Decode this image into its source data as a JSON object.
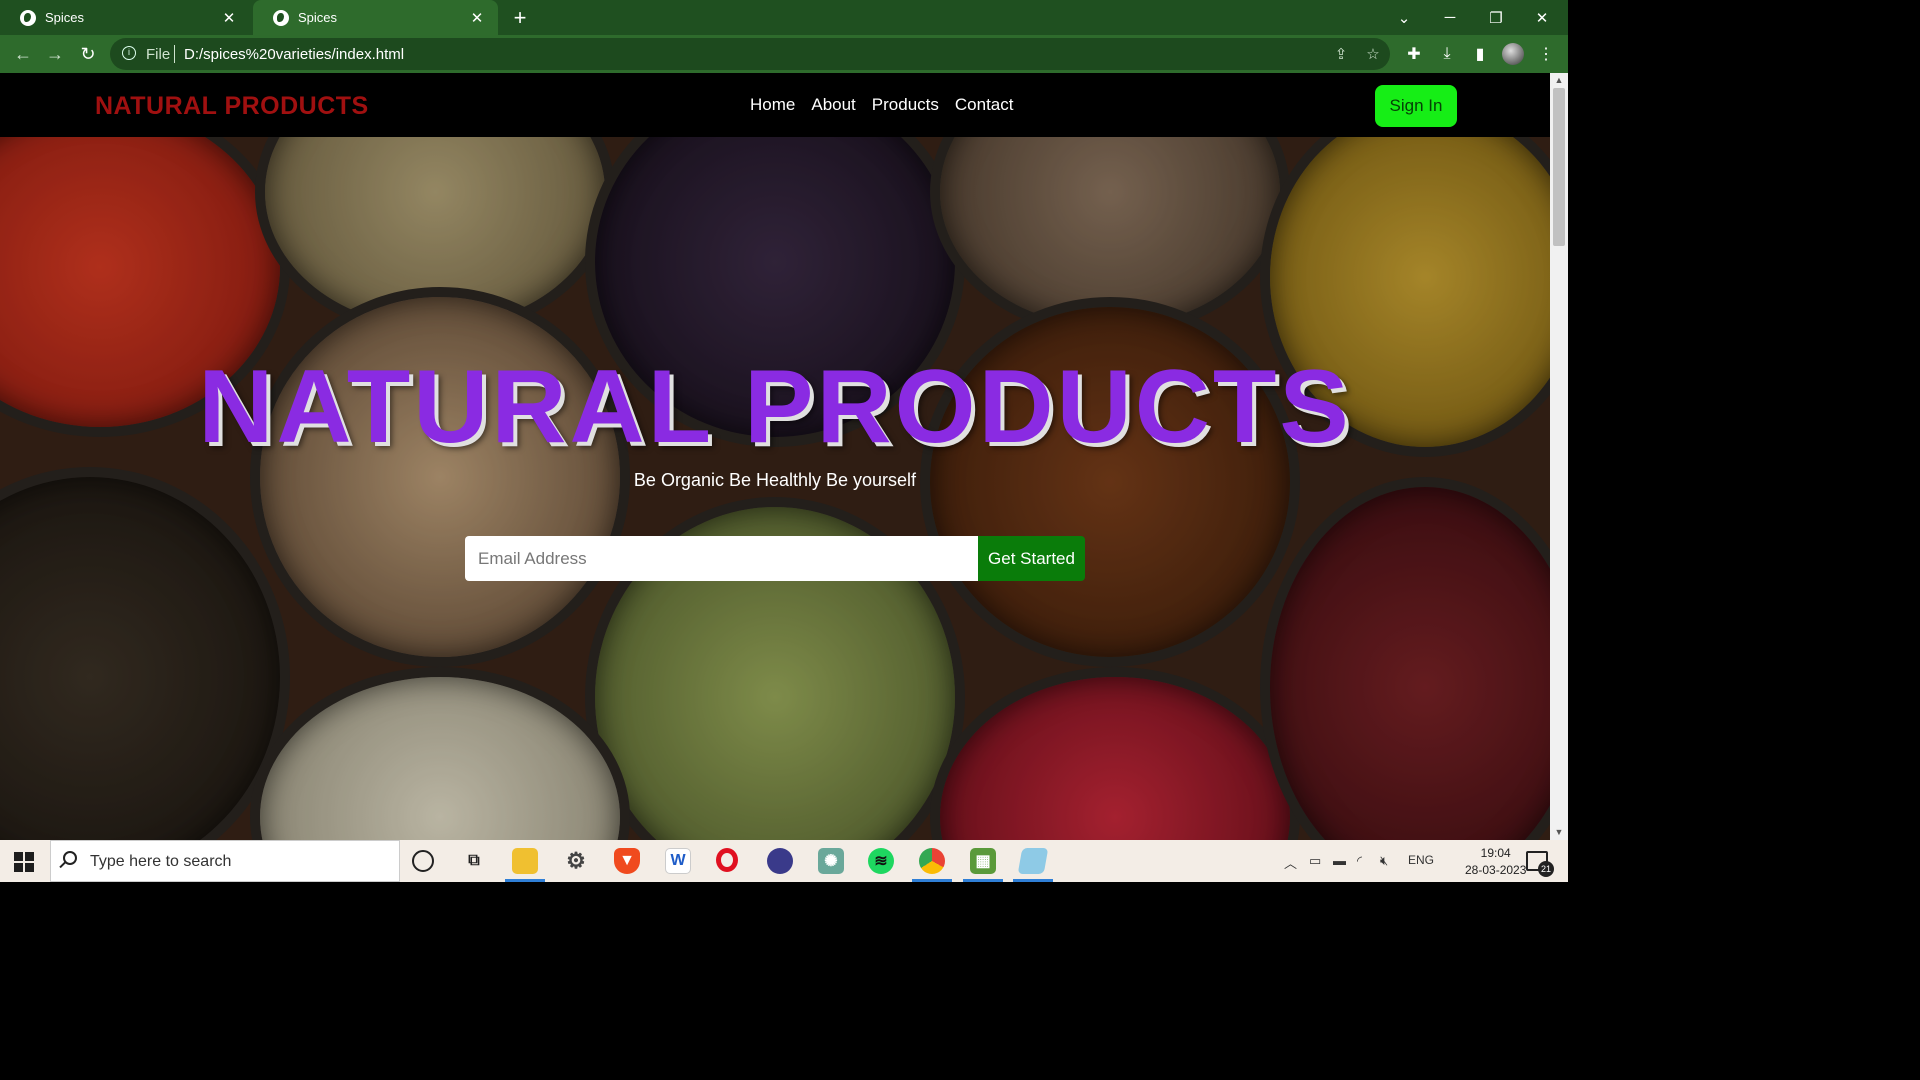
{
  "browser": {
    "tabs": [
      {
        "title": "Spices",
        "active": false
      },
      {
        "title": "Spices",
        "active": true
      }
    ],
    "address": {
      "scheme_label": "File",
      "url": "D:/spices%20varieties/index.html"
    }
  },
  "site": {
    "brand": "NATURAL PRODUCTS",
    "nav": [
      "Home",
      "About",
      "Products",
      "Contact"
    ],
    "signin_label": "Sign In",
    "hero": {
      "title": "NATURAL PRODUCTS",
      "subtitle": "Be Organic Be Healthly Be yourself",
      "email_placeholder": "Email Address",
      "cta_label": "Get Started"
    },
    "colors": {
      "brand": "#a01010",
      "title": "#8a2be2",
      "signin": "#16ee16",
      "cta": "#0a7c0a"
    }
  },
  "taskbar": {
    "search_placeholder": "Type here to search",
    "language": "ENG",
    "time": "19:04",
    "date": "28-03-2023",
    "notification_count": "21"
  }
}
